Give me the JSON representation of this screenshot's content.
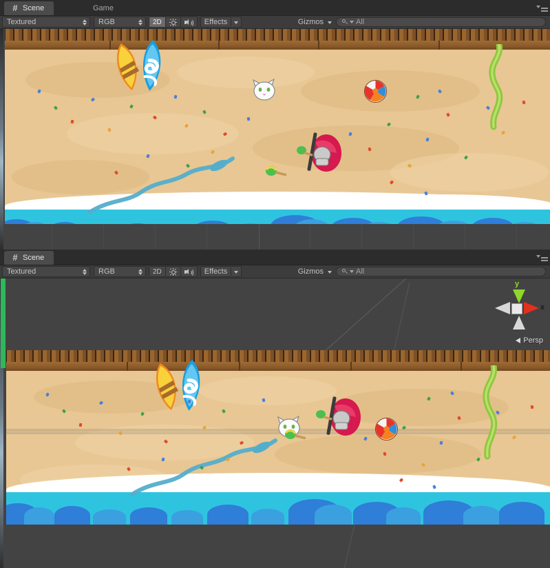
{
  "app": {
    "name": "Unity Editor",
    "background": "#3b3b3b"
  },
  "panels": [
    {
      "id": "scene-top",
      "tabs": [
        {
          "label": "Scene",
          "icon": "scene-hash-icon",
          "active": true
        },
        {
          "label": "Game",
          "icon": "game-icon",
          "active": false
        }
      ],
      "toolbar": {
        "draw_mode": "Textured",
        "color_mode": "RGB",
        "two_d_label": "2D",
        "two_d_active": true,
        "lighting_icon": "sun-icon",
        "audio_icon": "speaker-icon",
        "effects_label": "Effects",
        "gizmos_label": "Gizmos",
        "search_placeholder": "All",
        "search_value": ""
      },
      "options_menu": "panel-options-icon",
      "gizmo": {
        "visible": false
      }
    },
    {
      "id": "scene-bottom",
      "tabs": [
        {
          "label": "Scene",
          "icon": "scene-hash-icon",
          "active": true
        }
      ],
      "toolbar": {
        "draw_mode": "Textured",
        "color_mode": "RGB",
        "two_d_label": "2D",
        "two_d_active": false,
        "lighting_icon": "sun-icon",
        "audio_icon": "speaker-icon",
        "effects_label": "Effects",
        "gizmos_label": "Gizmos",
        "search_placeholder": "All",
        "search_value": ""
      },
      "options_menu": "panel-options-icon",
      "gizmo": {
        "visible": true,
        "x_label": "x",
        "y_label": "y",
        "projection_label": "Persp",
        "x_color": "#e3301c",
        "y_color": "#8fd72a",
        "z_color": "#d8d8d8"
      }
    }
  ],
  "scene": {
    "name": "beach-scene",
    "colors": {
      "sand": "#e8c794",
      "sand_light": "#f0d5a8",
      "sand_dark": "#dcb87f",
      "wood": "#8a5a2b",
      "wood_dark": "#4a2e14",
      "sea": "#2ec4e0",
      "sea_wave": "#2f7ed8",
      "sea_wave_light": "#3aa0e0",
      "foam": "#ffffff",
      "editor_bg": "#434343",
      "kelp": "#8ec63f",
      "umbrella": "#d6194e"
    },
    "objects": [
      {
        "name": "surfboard-yellow",
        "color": "#f7c52d"
      },
      {
        "name": "surfboard-blue",
        "color": "#2aa8e0"
      },
      {
        "name": "cat",
        "color": "#ffffff"
      },
      {
        "name": "beach-ball",
        "color": "#f05a28"
      },
      {
        "name": "kelp-vine",
        "color": "#8ec63f"
      },
      {
        "name": "player-character",
        "color": "#d6194e"
      },
      {
        "name": "maraca",
        "color": "#4cbf4c"
      },
      {
        "name": "driftwood",
        "color": "#c8a16a"
      },
      {
        "name": "fish",
        "color": "#4aa3c8"
      }
    ]
  }
}
